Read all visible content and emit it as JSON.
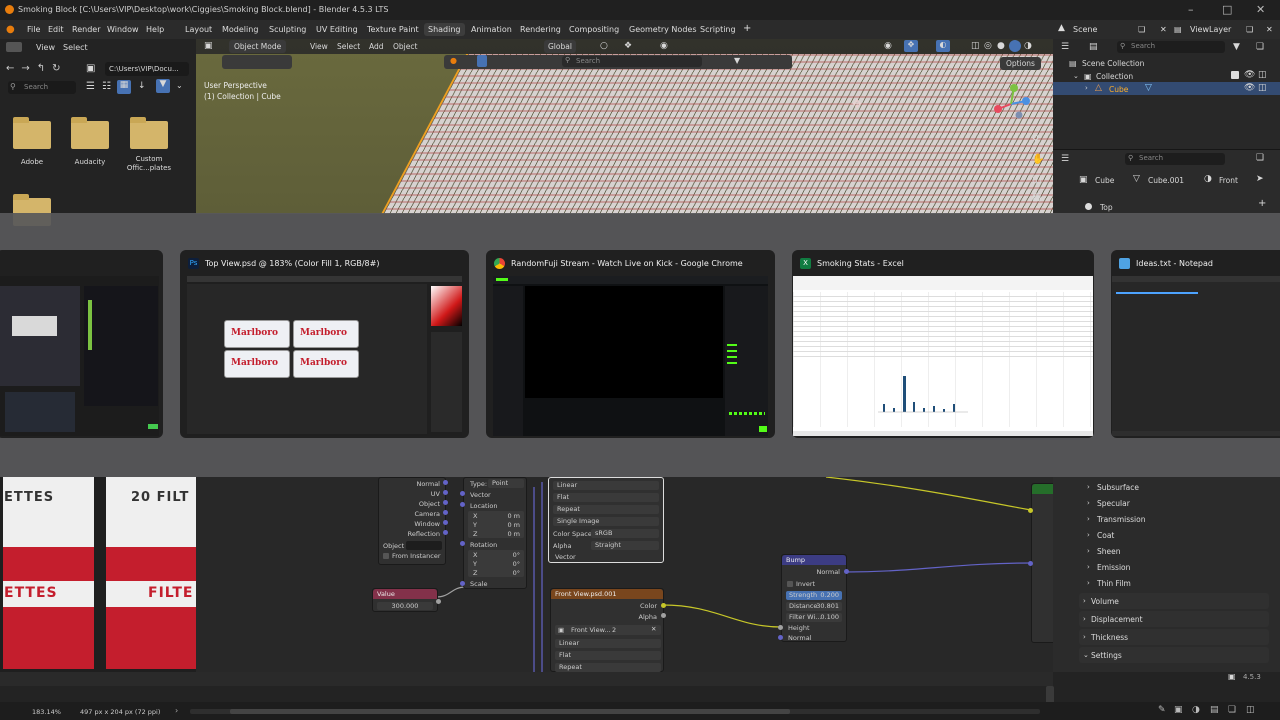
{
  "window": {
    "title": "Smoking Block [C:\\Users\\VIP\\Desktop\\work\\Ciggies\\Smoking Block.blend] - Blender 4.5.3 LTS"
  },
  "menu": [
    "File",
    "Edit",
    "Render",
    "Window",
    "Help"
  ],
  "workspaces": [
    "Layout",
    "Modeling",
    "Sculpting",
    "UV Editing",
    "Texture Paint",
    "Shading",
    "Animation",
    "Rendering",
    "Compositing",
    "Geometry Nodes",
    "Scripting"
  ],
  "active_workspace": "Shading",
  "scene": {
    "scene_name": "Scene",
    "view_layer": "ViewLayer"
  },
  "file_browser": {
    "menu": [
      "View",
      "Select"
    ],
    "path": "C:\\Users\\VIP\\Docu...",
    "search_placeholder": "Search",
    "folders": [
      "Adobe",
      "Audacity",
      "Custom Offic...plates"
    ]
  },
  "viewport": {
    "mode": "Object Mode",
    "menu": [
      "View",
      "Select",
      "Add",
      "Object"
    ],
    "orientation": "Global",
    "search_placeholder": "Search",
    "options_label": "Options",
    "info_line1": "User Perspective",
    "info_line2": "(1) Collection | Cube"
  },
  "outliner": {
    "search_placeholder": "Search",
    "items": [
      "Scene Collection",
      "Collection",
      "Cube"
    ]
  },
  "properties_top": {
    "search_placeholder": "Search",
    "breadcrumb": [
      "Cube",
      "Cube.001",
      "Front"
    ],
    "item": "Top"
  },
  "task_switcher": [
    {
      "title": "",
      "app": "blender"
    },
    {
      "title": "Top View.psd @ 183% (Color Fill 1, RGB/8#)",
      "app": "photoshop",
      "icon_text": "Ps"
    },
    {
      "title": "RandomFuji Stream - Watch Live on Kick - Google Chrome",
      "app": "chrome"
    },
    {
      "title": "Smoking Stats - Excel",
      "app": "excel",
      "icon_text": "X"
    },
    {
      "title": "Ideas.txt - Notepad",
      "app": "notepad"
    }
  ],
  "photoshop_preview": {
    "brand": "Marlboro"
  },
  "image_view": {
    "texts": [
      "ETTES",
      "20 FILT",
      "ETTES",
      "FILTE"
    ]
  },
  "node_editor": {
    "mapping_node": {
      "inputs": [
        "Normal",
        "UV",
        "Object",
        "Camera",
        "Window",
        "Reflection"
      ],
      "object_label": "Object",
      "from_instancer": "From Instancer"
    },
    "vector_node": {
      "type_label": "Type:",
      "type_value": "Point",
      "vector_label": "Vector",
      "location_label": "Location",
      "rotation_label": "Rotation",
      "scale_label": "Scale",
      "xyz": [
        "X",
        "Y",
        "Z"
      ],
      "loc_values": [
        "0 m",
        "0 m",
        "0 m"
      ],
      "rot_values": [
        "0°",
        "0°",
        "0°"
      ]
    },
    "image_node_top": {
      "options": [
        "Linear",
        "Flat",
        "Repeat",
        "Single Image"
      ],
      "color_space_label": "Color Space",
      "color_space_value": "sRGB",
      "alpha_label": "Alpha",
      "alpha_value": "Straight",
      "vector_label": "Vector"
    },
    "value_node": {
      "title": "Value",
      "value": "300.000"
    },
    "front_view_node": {
      "title": "Front View.psd.001",
      "color_label": "Color",
      "alpha_label": "Alpha",
      "image_name": "Front View...",
      "user_count": "2",
      "options": [
        "Linear",
        "Flat",
        "Repeat"
      ]
    },
    "bump_node": {
      "title": "Bump",
      "normal_label": "Normal",
      "invert_label": "Invert",
      "strength_label": "Strength",
      "strength_value": "0.200",
      "distance_label": "Distance",
      "distance_value": "30.801",
      "filter_label": "Filter Wi...",
      "filter_value": "0.100",
      "height_label": "Height",
      "normal_in_label": "Normal"
    }
  },
  "properties_bottom": {
    "sub_items": [
      "Subsurface",
      "Specular",
      "Transmission",
      "Coat",
      "Sheen",
      "Emission",
      "Thin Film"
    ],
    "sections": [
      "Volume",
      "Displacement",
      "Thickness",
      "Settings"
    ],
    "version": "4.5.3"
  },
  "status_bar": {
    "zoom": "183.14%",
    "doc_info": "497 px x 204 px (72 ppi)"
  },
  "colors": {
    "accent_blue": "#4772b3",
    "blender_orange": "#e87d0d",
    "node_purple": "#6363c7",
    "node_yellow": "#c7c729",
    "value_node_red": "#83314a",
    "image_node_header": "#79461d",
    "bump_header": "#3c3c83"
  }
}
